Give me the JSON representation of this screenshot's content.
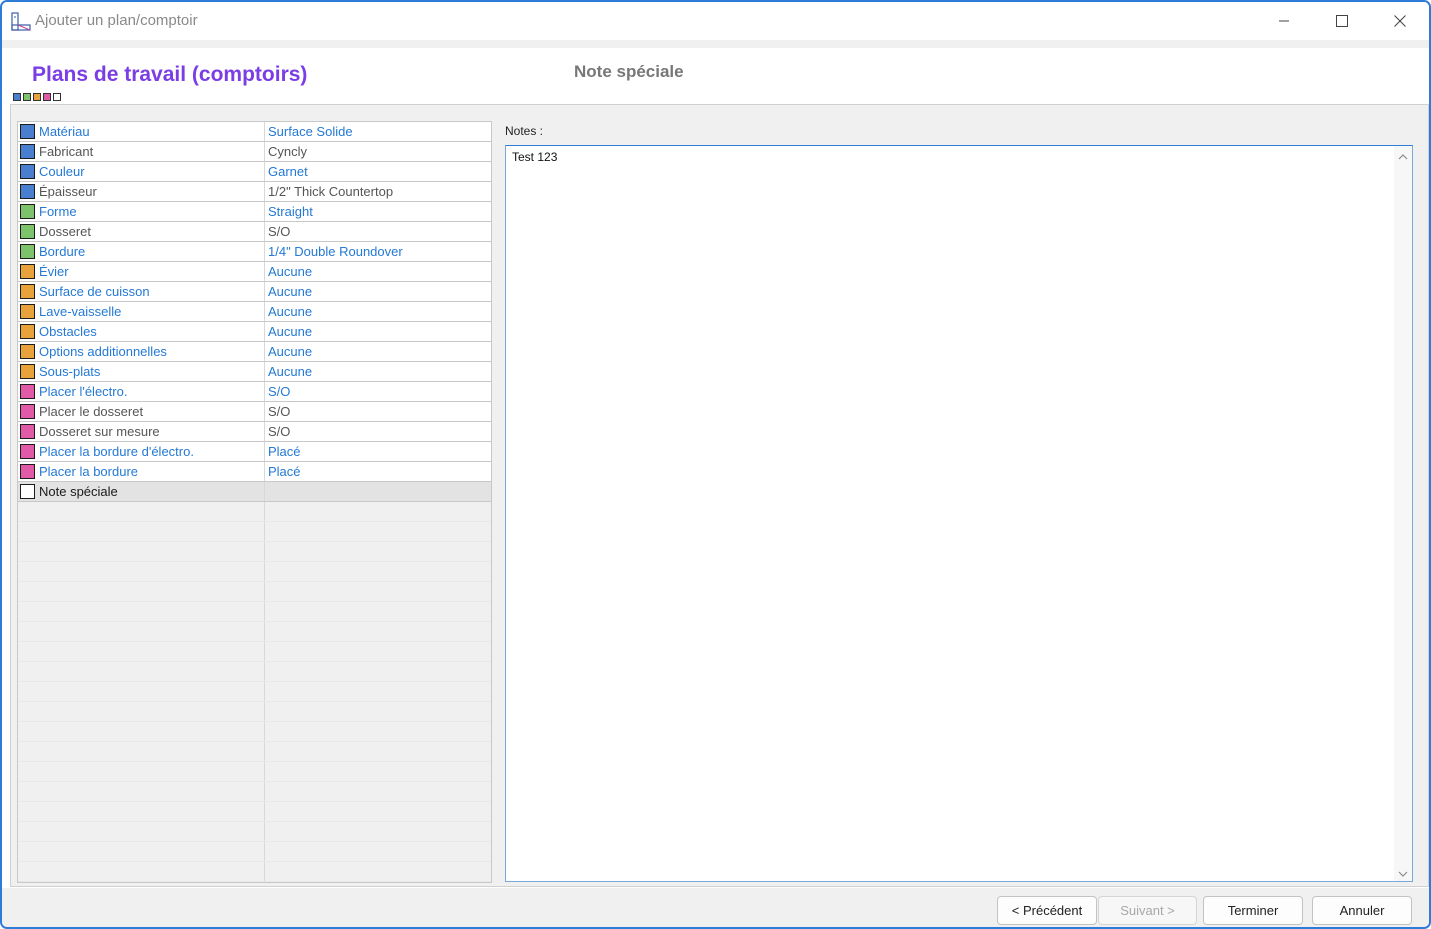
{
  "window": {
    "title": "Ajouter un plan/comptoir",
    "icon": "countertop-app-icon",
    "controls": [
      "minimize-icon",
      "maximize-icon",
      "close-icon"
    ]
  },
  "header": {
    "title": "Plans de travail (comptoirs)",
    "step_title": "Note spéciale",
    "step_dots": [
      "#4a7fcf",
      "#7cc36b",
      "#e8a23c",
      "#e05aa8",
      "#ffffff"
    ]
  },
  "colors": {
    "blue": "#4a7fcf",
    "green": "#7cc36b",
    "orange": "#e8a23c",
    "pink": "#e05aa8",
    "white": "#ffffff",
    "link": "#2479d4",
    "title": "#7a3de6"
  },
  "rows": [
    {
      "key": "Matériau",
      "value": "Surface Solide",
      "color": "#4a7fcf",
      "link": true
    },
    {
      "key": "Fabricant",
      "value": "Cyncly",
      "color": "#4a7fcf",
      "link": false
    },
    {
      "key": "Couleur",
      "value": "Garnet",
      "color": "#4a7fcf",
      "link": true
    },
    {
      "key": "Épaisseur",
      "value": "1/2\" Thick Countertop",
      "color": "#4a7fcf",
      "link": false
    },
    {
      "key": "Forme",
      "value": "Straight",
      "color": "#7cc36b",
      "link": true
    },
    {
      "key": "Dosseret",
      "value": "S/O",
      "color": "#7cc36b",
      "link": false
    },
    {
      "key": "Bordure",
      "value": "1/4\" Double Roundover",
      "color": "#7cc36b",
      "link": true
    },
    {
      "key": "Évier",
      "value": "Aucune",
      "color": "#e8a23c",
      "link": true
    },
    {
      "key": "Surface de cuisson",
      "value": "Aucune",
      "color": "#e8a23c",
      "link": true
    },
    {
      "key": "Lave-vaisselle",
      "value": "Aucune",
      "color": "#e8a23c",
      "link": true
    },
    {
      "key": "Obstacles",
      "value": "Aucune",
      "color": "#e8a23c",
      "link": true
    },
    {
      "key": "Options additionnelles",
      "value": "Aucune",
      "color": "#e8a23c",
      "link": true
    },
    {
      "key": "Sous-plats",
      "value": "Aucune",
      "color": "#e8a23c",
      "link": true
    },
    {
      "key": "Placer l'électro.",
      "value": "S/O",
      "color": "#e05aa8",
      "link": true
    },
    {
      "key": "Placer le dosseret",
      "value": "S/O",
      "color": "#e05aa8",
      "link": false
    },
    {
      "key": "Dosseret sur mesure",
      "value": "S/O",
      "color": "#e05aa8",
      "link": false
    },
    {
      "key": "Placer la bordure d'électro.",
      "value": "Placé",
      "color": "#e05aa8",
      "link": true
    },
    {
      "key": "Placer la bordure",
      "value": "Placé",
      "color": "#e05aa8",
      "link": true
    },
    {
      "key": "Note spéciale",
      "value": "",
      "color": "#ffffff",
      "link": false,
      "selected": true
    }
  ],
  "notes": {
    "label": "Notes :",
    "value": "Test 123"
  },
  "footer": {
    "previous": "< Précédent",
    "next": "Suivant >",
    "finish": "Terminer",
    "cancel": "Annuler"
  }
}
